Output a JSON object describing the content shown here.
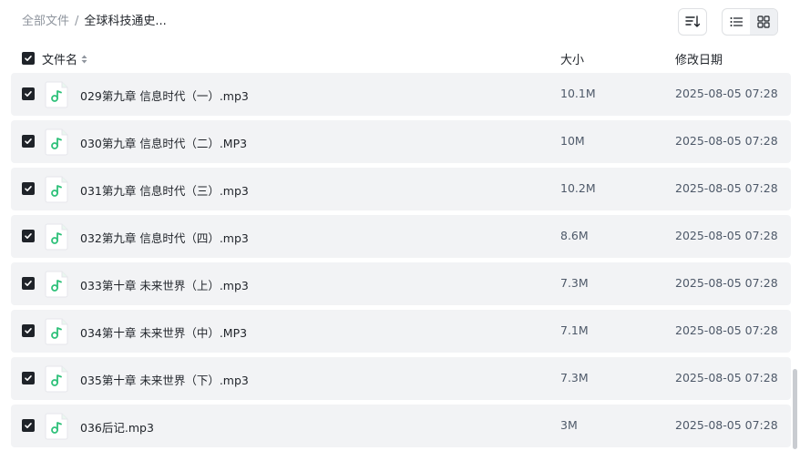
{
  "breadcrumb": {
    "root": "全部文件",
    "separator": "/",
    "current": "全球科技通史..."
  },
  "toolbar": {
    "sort_icon": "sort-icon",
    "list_view_icon": "list-view-icon",
    "grid_view_icon": "grid-view-icon",
    "active_view": "list"
  },
  "table": {
    "header": {
      "name": "文件名",
      "size": "大小",
      "modified": "修改日期"
    },
    "rows": [
      {
        "name": "029第九章 信息时代（一）.mp3",
        "size": "10.1M",
        "modified": "2025-08-05 07:28",
        "checked": true
      },
      {
        "name": "030第九章 信息时代（二）.MP3",
        "size": "10M",
        "modified": "2025-08-05 07:28",
        "checked": true
      },
      {
        "name": "031第九章 信息时代（三）.mp3",
        "size": "10.2M",
        "modified": "2025-08-05 07:28",
        "checked": true
      },
      {
        "name": "032第九章 信息时代（四）.mp3",
        "size": "8.6M",
        "modified": "2025-08-05 07:28",
        "checked": true
      },
      {
        "name": "033第十章 未来世界（上）.mp3",
        "size": "7.3M",
        "modified": "2025-08-05 07:28",
        "checked": true
      },
      {
        "name": "034第十章 未来世界（中）.MP3",
        "size": "7.1M",
        "modified": "2025-08-05 07:28",
        "checked": true
      },
      {
        "name": "035第十章 未来世界（下）.mp3",
        "size": "7.3M",
        "modified": "2025-08-05 07:28",
        "checked": true
      },
      {
        "name": "036后记.mp3",
        "size": "3M",
        "modified": "2025-08-05 07:28",
        "checked": true
      }
    ]
  },
  "colors": {
    "row_bg": "#f2f3f5",
    "audio_icon": "#2fc17a",
    "checkbox": "#1f2329"
  }
}
